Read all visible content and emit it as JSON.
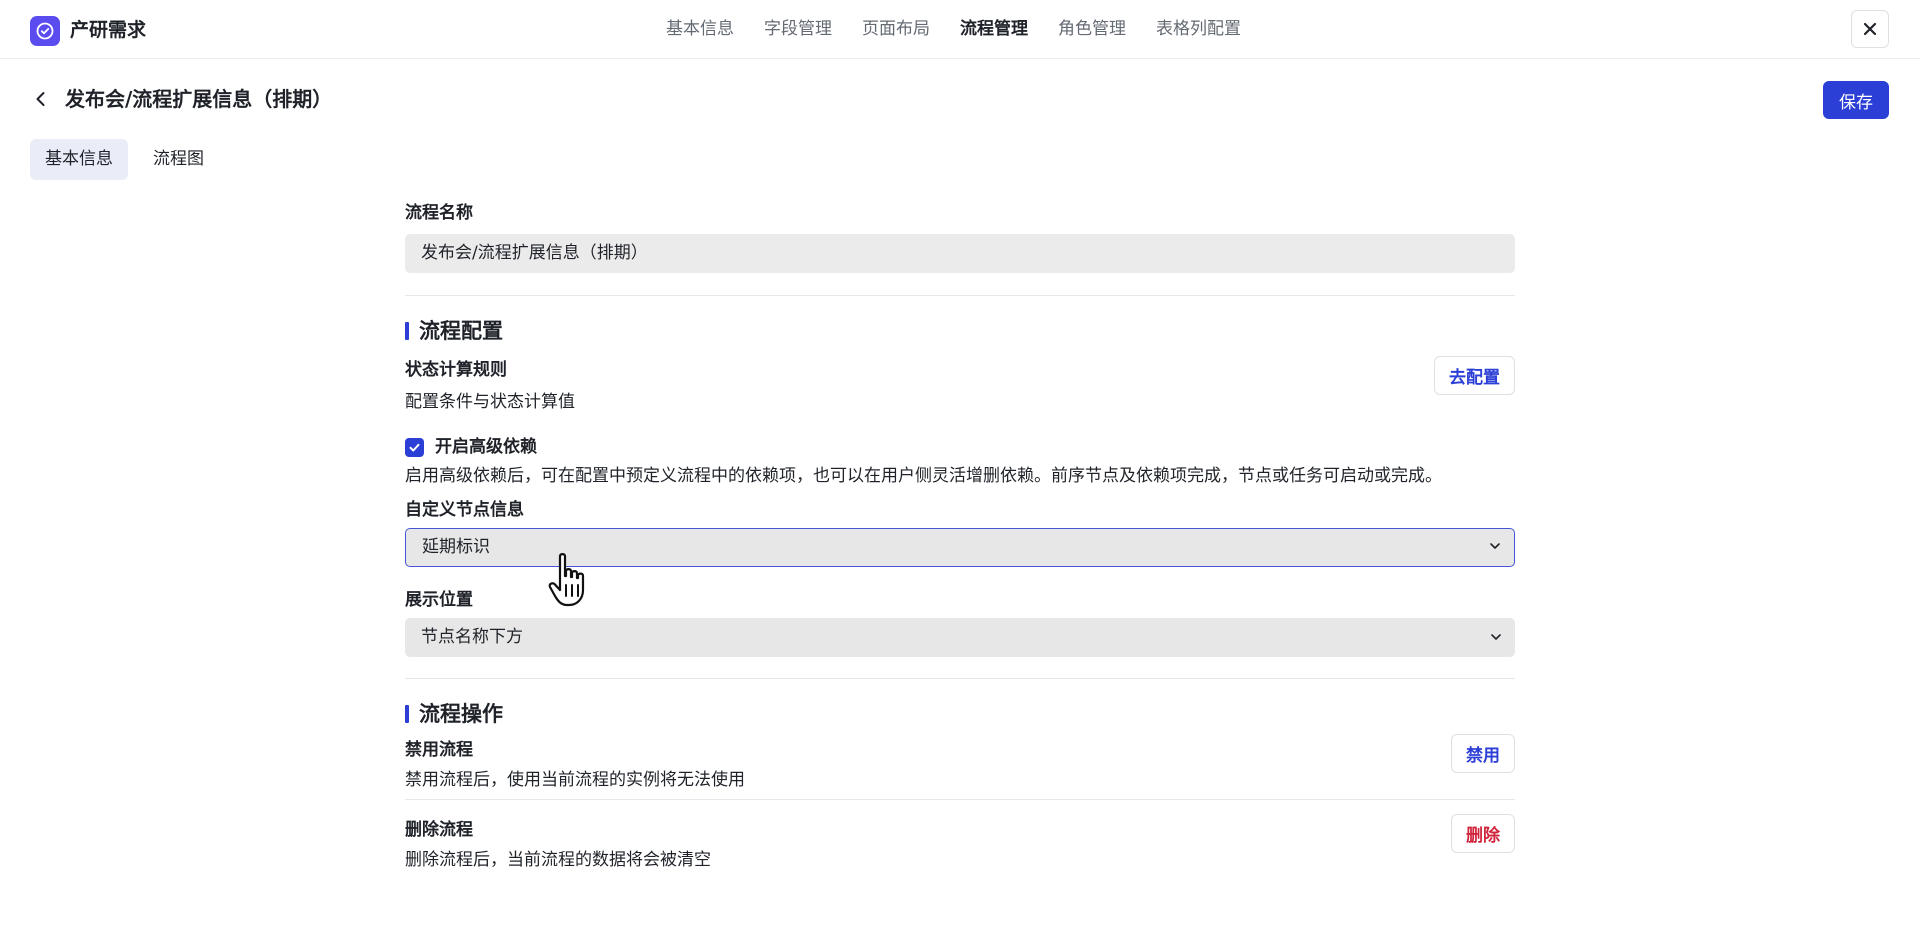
{
  "app": {
    "title": "产研需求",
    "logo_icon": "check-circle-icon",
    "accent": "#2b3fd6"
  },
  "top_nav": {
    "items": [
      "基本信息",
      "字段管理",
      "页面布局",
      "流程管理",
      "角色管理",
      "表格列配置"
    ],
    "active": "流程管理"
  },
  "header": {
    "title": "发布会/流程扩展信息（排期）",
    "save_label": "保存"
  },
  "subtabs": {
    "items": [
      "基本信息",
      "流程图"
    ],
    "active": "基本信息"
  },
  "form": {
    "name_label": "流程名称",
    "name_value": "发布会/流程扩展信息（排期）",
    "config_section_title": "流程配置",
    "status_rule_title": "状态计算规则",
    "status_rule_desc": "配置条件与状态计算值",
    "status_rule_button": "去配置",
    "advanced_dep_label": "开启高级依赖",
    "advanced_dep_checked": true,
    "advanced_dep_desc": "启用高级依赖后，可在配置中预定义流程中的依赖项，也可以在用户侧灵活增删依赖。前序节点及依赖项完成，节点或任务可启动或完成。",
    "custom_node_label": "自定义节点信息",
    "custom_node_value": "延期标识",
    "display_pos_label": "展示位置",
    "display_pos_value": "节点名称下方",
    "ops_section_title": "流程操作",
    "disable_title": "禁用流程",
    "disable_desc": "禁用流程后，使用当前流程的实例将无法使用",
    "disable_button": "禁用",
    "delete_title": "删除流程",
    "delete_desc": "删除流程后，当前流程的数据将会被清空",
    "delete_button": "删除"
  }
}
